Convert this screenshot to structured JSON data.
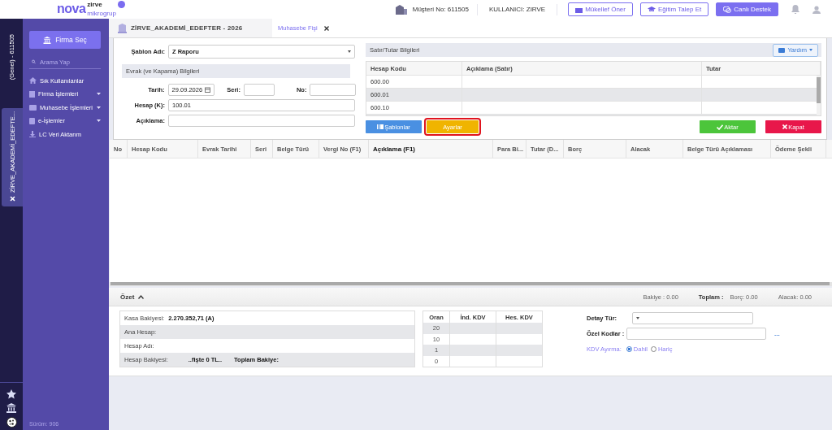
{
  "header": {
    "logo": {
      "top": "zirve",
      "main": "nova",
      "sub": "mikrogrup"
    },
    "customer_no": "Müşteri No: 611505",
    "user": "KULLANICI: ZIRVE",
    "buttons": [
      {
        "label": "Mükellef Öner",
        "kind": "outline"
      },
      {
        "label": "Eğitim Talep Et",
        "kind": "outline"
      },
      {
        "label": "Canlı Destek",
        "kind": "filled"
      }
    ]
  },
  "rail": {
    "company": "(Genel) - 611505",
    "tab": "ZİRVE_AKADEMİ_EDEFTE..."
  },
  "sidebar": {
    "firm_button": "Firma Seç",
    "search": {
      "placeholder": "Arama Yap"
    },
    "items": [
      {
        "label": "Sık Kullanılanlar",
        "expandable": false
      },
      {
        "label": "Firma İşlemleri",
        "expandable": true
      },
      {
        "label": "Muhasebe İşlemleri",
        "expandable": true
      },
      {
        "label": "e-İşlemler",
        "expandable": true
      },
      {
        "label": "LC Veri Aktarım",
        "expandable": false
      }
    ],
    "version": "Sürüm: 906"
  },
  "tabs": {
    "company": "ZİRVE_AKADEMİ_EDEFTER - 2026",
    "items": [
      {
        "label": "Muhasebe Fişi",
        "selected": true
      }
    ]
  },
  "form": {
    "template": {
      "label": "Şablon Adı:",
      "value": "Z Raporu"
    },
    "section": "Evrak (ve Kapama) Bilgileri",
    "date": {
      "label": "Tarih:",
      "value": "29.09.2026"
    },
    "series": {
      "label": "Seri:"
    },
    "number": {
      "label": "No:"
    },
    "account": {
      "label": "Hesap (K):",
      "value": "100.01"
    },
    "description": {
      "label": "Açıklama:"
    }
  },
  "lines": {
    "title": "Satır/Tutar Bilgileri",
    "help": "Yardım",
    "columns": [
      "Hesap Kodu",
      "Açıklama (Satır)",
      "Tutar"
    ],
    "rows": [
      "600.00",
      "600.01",
      "600.10"
    ]
  },
  "actions": [
    {
      "label": "Şablonlar",
      "kind": "primary",
      "highlighted": false
    },
    {
      "label": "Ayarlar",
      "kind": "warning",
      "highlighted": true
    },
    {
      "label": "Aktar",
      "kind": "success",
      "highlighted": false
    },
    {
      "label": "Kapat",
      "kind": "danger",
      "highlighted": false
    }
  ],
  "grid": {
    "columns": [
      {
        "label": "No",
        "emphasized": false
      },
      {
        "label": "Hesap Kodu",
        "emphasized": false
      },
      {
        "label": "Evrak Tarihi",
        "emphasized": false
      },
      {
        "label": "Seri",
        "emphasized": false
      },
      {
        "label": "Belge Türü",
        "emphasized": false
      },
      {
        "label": "Vergi No (F1)",
        "emphasized": false
      },
      {
        "label": "Açıklama (F1)",
        "emphasized": true
      },
      {
        "label": "Para Bi...",
        "emphasized": false
      },
      {
        "label": "Tutar (D...",
        "emphasized": false
      },
      {
        "label": "Borç",
        "emphasized": false
      },
      {
        "label": "Alacak",
        "emphasized": false
      },
      {
        "label": "Belge Türü Açıklaması",
        "emphasized": false
      },
      {
        "label": "Ödeme Şekli",
        "emphasized": false
      }
    ]
  },
  "summary": {
    "title": "Özet",
    "expanded": true,
    "balance": "Bakiye : 0.00",
    "total_label": "Toplam :",
    "debit": "Borç: 0.00",
    "credit": "Alacak: 0.00"
  },
  "balances": [
    {
      "label": "Kasa Bakiyesi:",
      "value": "2.270.352,71 (A)"
    },
    {
      "label": "Ana Hesap:"
    },
    {
      "label": "Hesap Adı:"
    },
    {
      "label": "Hesap Bakiyesi:",
      "value": "..fişte 0 TL..",
      "extra": "Toplam Bakiye:"
    }
  ],
  "vat": {
    "columns": [
      "Oran",
      "İnd. KDV",
      "Hes. KDV"
    ],
    "rows": [
      "20",
      "10",
      "1",
      "0"
    ]
  },
  "details": {
    "type": {
      "label": "Detay Tür:"
    },
    "codes": {
      "label": "Özel Kodlar :",
      "more": "..."
    },
    "vat_split": {
      "label": "KDV Ayırma:",
      "options": [
        {
          "label": "Dahil",
          "selected": true
        },
        {
          "label": "Hariç",
          "selected": false
        }
      ]
    }
  }
}
